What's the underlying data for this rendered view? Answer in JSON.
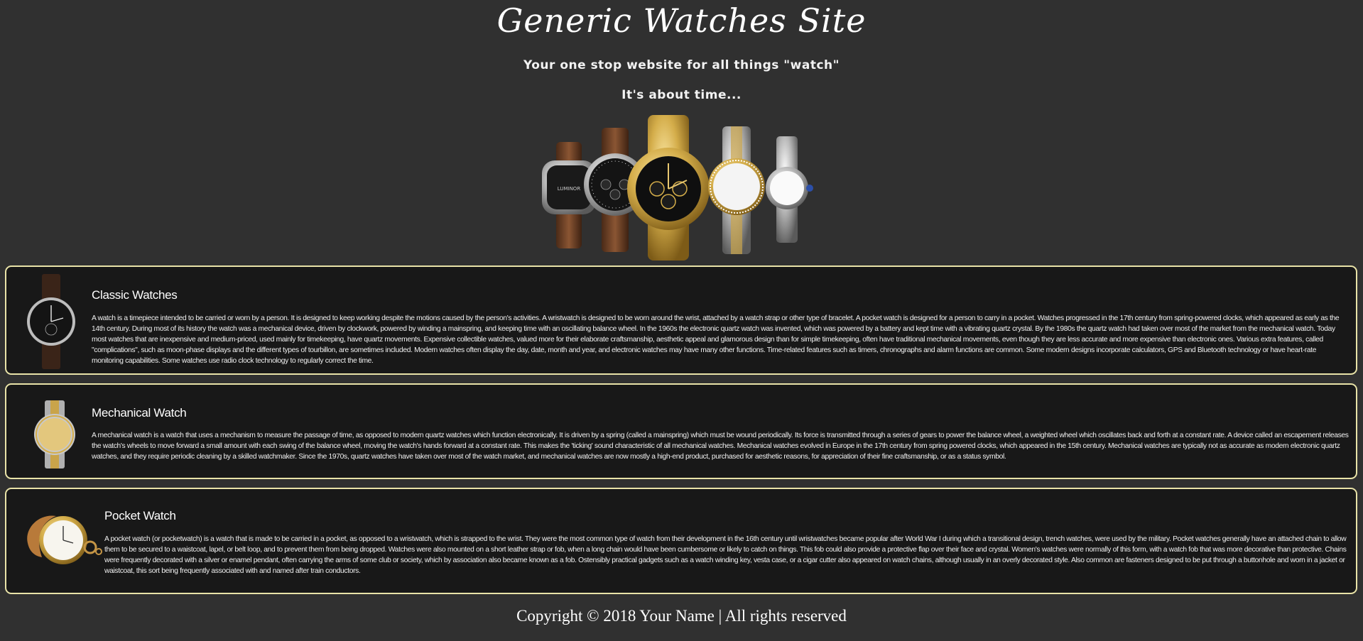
{
  "header": {
    "title": "Generic Watches Site",
    "tagline": "Your one stop website for all things \"watch\"",
    "subtagline": "It's about time..."
  },
  "sections": [
    {
      "title": "Classic Watches",
      "icon": "wristwatch-leather-icon",
      "body": "A watch is a timepiece intended to be carried or worn by a person. It is designed to keep working despite the motions caused by the person's activities. A wristwatch is designed to be worn around the wrist, attached by a watch strap or other type of bracelet. A pocket watch is designed for a person to carry in a pocket. Watches progressed in the 17th century from spring-powered clocks, which appeared as early as the 14th century. During most of its history the watch was a mechanical device, driven by clockwork, powered by winding a mainspring, and keeping time with an oscillating balance wheel. In the 1960s the electronic quartz watch was invented, which was powered by a battery and kept time with a vibrating quartz crystal. By the 1980s the quartz watch had taken over most of the market from the mechanical watch. Today most watches that are inexpensive and medium-priced, used mainly for timekeeping, have quartz movements. Expensive collectible watches, valued more for their elaborate craftsmanship, aesthetic appeal and glamorous design than for simple timekeeping, often have traditional mechanical movements, even though they are less accurate and more expensive than electronic ones. Various extra features, called \"complications\", such as moon-phase displays and the different types of tourbillon, are sometimes included. Modern watches often display the day, date, month and year, and electronic watches may have many other functions. Time-related features such as timers, chronographs and alarm functions are common. Some modern designs incorporate calculators, GPS and Bluetooth technology or have heart-rate monitoring capabilities. Some watches use radio clock technology to regularly correct the time."
    },
    {
      "title": "Mechanical Watch",
      "icon": "mechanical-watch-icon",
      "body": "A mechanical watch is a watch that uses a mechanism to measure the passage of time, as opposed to modern quartz watches which function electronically. It is driven by a spring (called a mainspring) which must be wound periodically. Its force is transmitted through a series of gears to power the balance wheel, a weighted wheel which oscillates back and forth at a constant rate. A device called an escapement releases the watch's wheels to move forward a small amount with each swing of the balance wheel, moving the watch's hands forward at a constant rate. This makes the 'ticking' sound characteristic of all mechanical watches. Mechanical watches evolved in Europe in the 17th century from spring powered clocks, which appeared in the 15th century. Mechanical watches are typically not as accurate as modern electronic quartz watches, and they require periodic cleaning by a skilled watchmaker. Since the 1970s, quartz watches have taken over most of the watch market, and mechanical watches are now mostly a high-end product, purchased for aesthetic reasons, for appreciation of their fine craftsmanship, or as a status symbol."
    },
    {
      "title": "Pocket Watch",
      "icon": "pocket-watch-icon",
      "body": "A pocket watch (or pocketwatch) is a watch that is made to be carried in a pocket, as opposed to a wristwatch, which is strapped to the wrist. They were the most common type of watch from their development in the 16th century until wristwatches became popular after World War I during which a transitional design, trench watches, were used by the military. Pocket watches generally have an attached chain to allow them to be secured to a waistcoat, lapel, or belt loop, and to prevent them from being dropped. Watches were also mounted on a short leather strap or fob, when a long chain would have been cumbersome or likely to catch on things. This fob could also provide a protective flap over their face and crystal. Women's watches were normally of this form, with a watch fob that was more decorative than protective. Chains were frequently decorated with a silver or enamel pendant, often carrying the arms of some club or society, which by association also became known as a fob. Ostensibly practical gadgets such as a watch winding key, vesta case, or a cigar cutter also appeared on watch chains, although usually in an overly decorated style. Also common are fasteners designed to be put through a buttonhole and worn in a jacket or waistcoat, this sort being frequently associated with and named after train conductors."
    }
  ],
  "footer": {
    "copyright": "Copyright © 2018 Your Name | All rights reserved"
  },
  "colors": {
    "page_bg": "#303030",
    "card_bg": "#181818",
    "card_border": "#e9e3a8",
    "text": "#ffffff",
    "gold": "#d4ad4a"
  }
}
